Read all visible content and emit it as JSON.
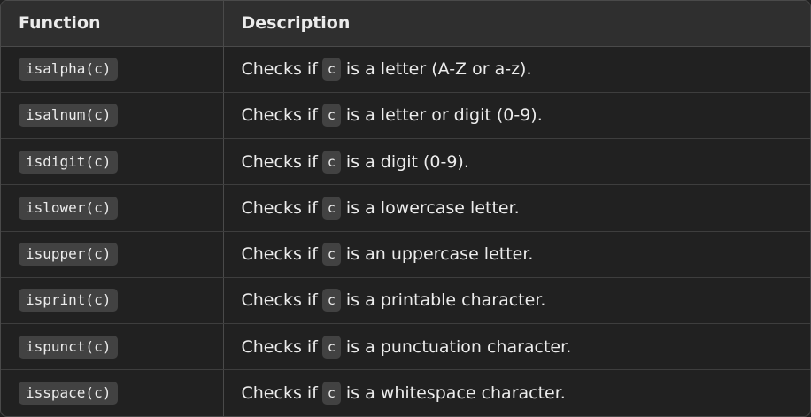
{
  "table": {
    "headers": {
      "function": "Function",
      "description": "Description"
    },
    "rows": [
      {
        "function": "isalpha(c)",
        "prefix": "Checks if",
        "code": "c",
        "suffix": "is a letter (A-Z or a-z)."
      },
      {
        "function": "isalnum(c)",
        "prefix": "Checks if",
        "code": "c",
        "suffix": "is a letter or digit (0-9)."
      },
      {
        "function": "isdigit(c)",
        "prefix": "Checks if",
        "code": "c",
        "suffix": "is a digit (0-9)."
      },
      {
        "function": "islower(c)",
        "prefix": "Checks if",
        "code": "c",
        "suffix": "is a lowercase letter."
      },
      {
        "function": "isupper(c)",
        "prefix": "Checks if",
        "code": "c",
        "suffix": "is an uppercase letter."
      },
      {
        "function": "isprint(c)",
        "prefix": "Checks if",
        "code": "c",
        "suffix": "is a printable character."
      },
      {
        "function": "ispunct(c)",
        "prefix": "Checks if",
        "code": "c",
        "suffix": "is a punctuation character."
      },
      {
        "function": "isspace(c)",
        "prefix": "Checks if",
        "code": "c",
        "suffix": "is a whitespace character."
      }
    ]
  }
}
